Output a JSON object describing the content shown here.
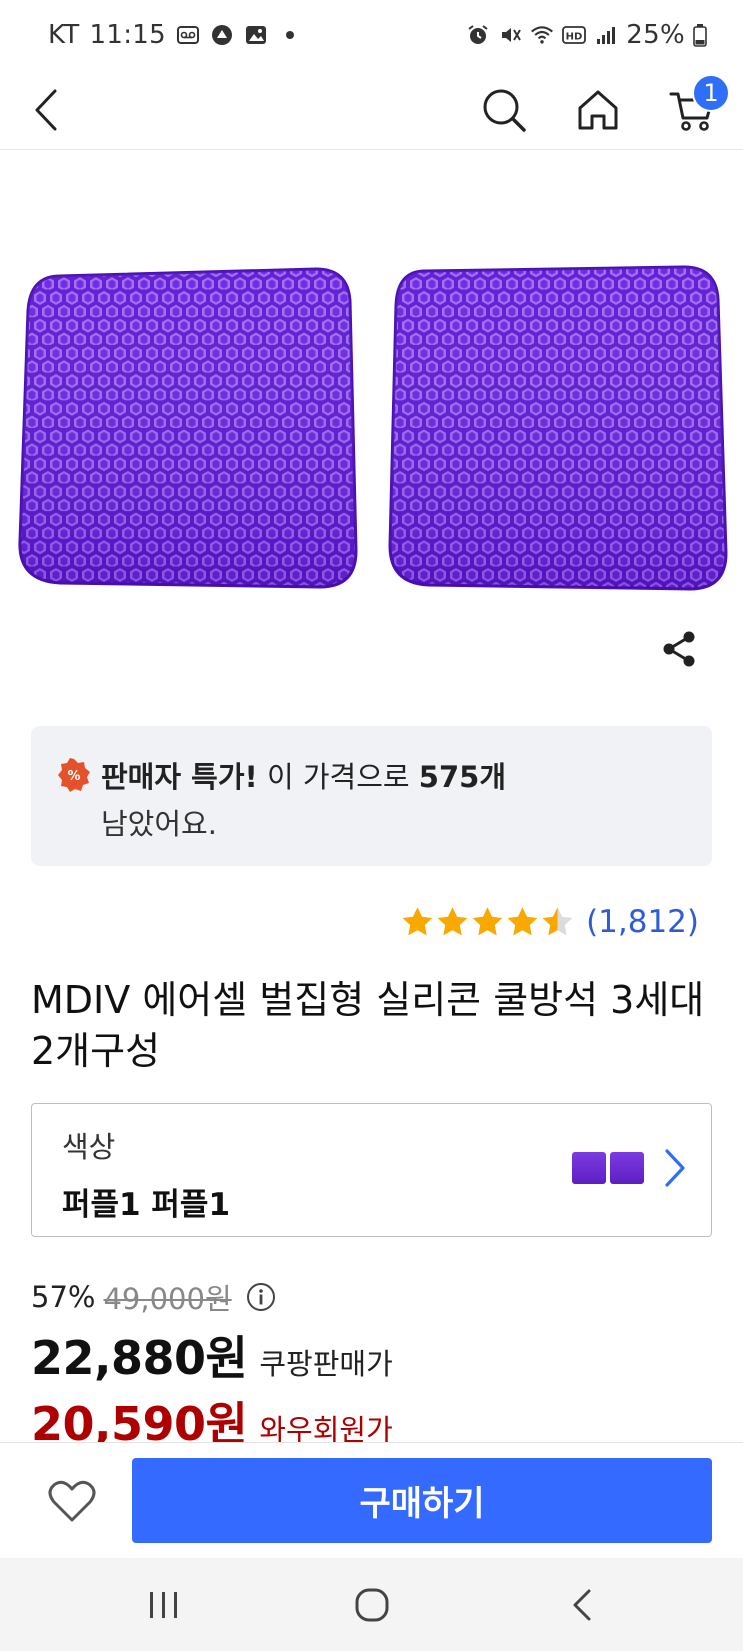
{
  "status_bar": {
    "carrier": "KT",
    "time": "11:15",
    "battery": "25%"
  },
  "nav": {
    "cart_count": "1"
  },
  "promo": {
    "label": "판매자 특가!",
    "text_before": " 이 가격으로 ",
    "count": "575개",
    "text_after": "남았어요.",
    "icon_symbol": "%"
  },
  "rating": {
    "stars": 4.5,
    "count": "(1,812)"
  },
  "product": {
    "title": "MDIV 에어셀 벌집형 실리콘 쿨방석 3세대 2개구성",
    "color_hex": "#6a24d6"
  },
  "option": {
    "label": "색상",
    "value": "퍼플1 퍼플1"
  },
  "price": {
    "discount_rate": "57%",
    "original": "49,000원",
    "sale": "22,880원",
    "sale_label": "쿠팡판매가",
    "wow": "20,590원",
    "wow_label": "와우회원가",
    "wow_color": "#ae0000"
  },
  "actions": {
    "buy_label": "구매하기",
    "accent": "#346aff"
  }
}
